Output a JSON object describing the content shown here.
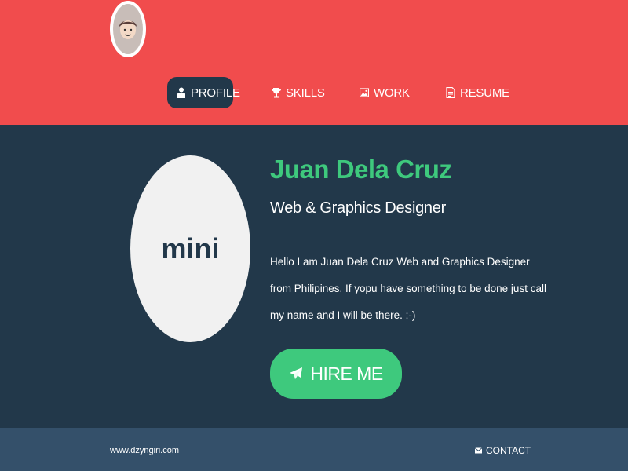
{
  "header": {
    "avatar_icon": "cartoon-face-avatar",
    "nav": [
      {
        "label": "PROFILE",
        "icon": "user-icon",
        "active": true
      },
      {
        "label": "SKILLS",
        "icon": "trophy-icon",
        "active": false
      },
      {
        "label": "WORK",
        "icon": "image-icon",
        "active": false
      },
      {
        "label": "RESUME",
        "icon": "document-icon",
        "active": false
      }
    ]
  },
  "profile": {
    "photo_text": "mini",
    "name": "Juan Dela Cruz",
    "role": "Web & Graphics Designer",
    "bio_lines": [
      "Hello I am Juan Dela Cruz Web and Graphics Designer",
      "from Philipines. If yopu have something to be done just call",
      "my name and I will be there. :-)"
    ],
    "hire_label": "HIRE ME",
    "hire_icon": "paper-plane-icon"
  },
  "footer": {
    "site": "www.dzyngiri.com",
    "contact_label": "CONTACT",
    "contact_icon": "envelope-icon"
  },
  "colors": {
    "header_bg": "#f14c4d",
    "main_bg": "#22384a",
    "accent_green": "#3ec97d",
    "footer_bg": "#34506a",
    "photo_bg": "#f1f1f1"
  }
}
